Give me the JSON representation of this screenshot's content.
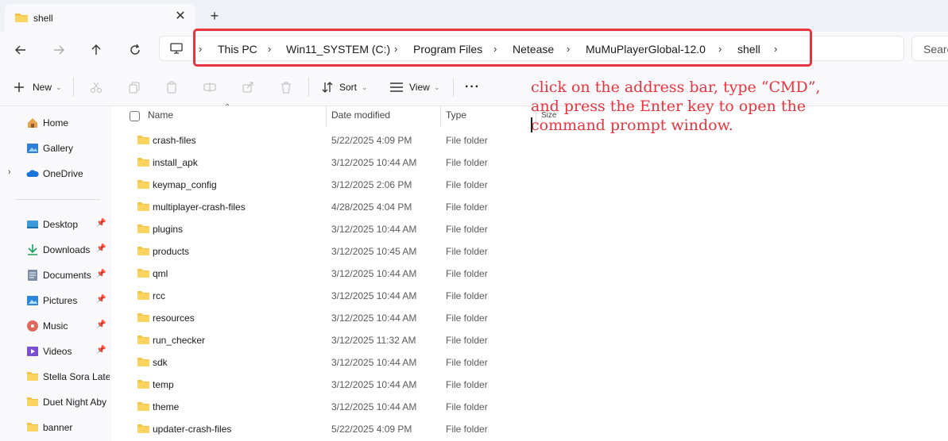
{
  "window": {
    "tab_title": "shell",
    "tab_close": "✕",
    "new_tab": "+"
  },
  "address_bar": {
    "crumbs": [
      "This PC",
      "Win11_SYSTEM (C:)",
      "Program Files",
      "Netease",
      "MuMuPlayerGlobal-12.0",
      "shell"
    ],
    "separator": "›"
  },
  "search": {
    "placeholder": "Search"
  },
  "toolbar": {
    "new_label": "New",
    "sort_label": "Sort",
    "view_label": "View",
    "more_label": "···"
  },
  "sidebar": {
    "items": [
      {
        "label": "Home",
        "icon": "home-icon"
      },
      {
        "label": "Gallery",
        "icon": "gallery-icon"
      },
      {
        "label": "OneDrive",
        "icon": "cloud-icon"
      },
      {
        "label": "Desktop",
        "icon": "desktop-icon"
      },
      {
        "label": "Downloads",
        "icon": "download-icon"
      },
      {
        "label": "Documents",
        "icon": "document-icon"
      },
      {
        "label": "Pictures",
        "icon": "pictures-icon"
      },
      {
        "label": "Music",
        "icon": "music-icon"
      },
      {
        "label": "Videos",
        "icon": "video-icon"
      },
      {
        "label": "Stella Sora Lates",
        "icon": "folder-icon"
      },
      {
        "label": "Duet Night Aby",
        "icon": "folder-icon"
      },
      {
        "label": "banner",
        "icon": "folder-icon"
      }
    ]
  },
  "columns": {
    "name": "Name",
    "date": "Date modified",
    "type": "Type",
    "size": "Size"
  },
  "files": [
    {
      "name": "crash-files",
      "date": "5/22/2025 4:09 PM",
      "type": "File folder"
    },
    {
      "name": "install_apk",
      "date": "3/12/2025 10:44 AM",
      "type": "File folder"
    },
    {
      "name": "keymap_config",
      "date": "3/12/2025 2:06 PM",
      "type": "File folder"
    },
    {
      "name": "multiplayer-crash-files",
      "date": "4/28/2025 4:04 PM",
      "type": "File folder"
    },
    {
      "name": "plugins",
      "date": "3/12/2025 10:44 AM",
      "type": "File folder"
    },
    {
      "name": "products",
      "date": "3/12/2025 10:45 AM",
      "type": "File folder"
    },
    {
      "name": "qml",
      "date": "3/12/2025 10:44 AM",
      "type": "File folder"
    },
    {
      "name": "rcc",
      "date": "3/12/2025 10:44 AM",
      "type": "File folder"
    },
    {
      "name": "resources",
      "date": "3/12/2025 10:44 AM",
      "type": "File folder"
    },
    {
      "name": "run_checker",
      "date": "3/12/2025 11:32 AM",
      "type": "File folder"
    },
    {
      "name": "sdk",
      "date": "3/12/2025 10:44 AM",
      "type": "File folder"
    },
    {
      "name": "temp",
      "date": "3/12/2025 10:44 AM",
      "type": "File folder"
    },
    {
      "name": "theme",
      "date": "3/12/2025 10:44 AM",
      "type": "File folder"
    },
    {
      "name": "updater-crash-files",
      "date": "5/22/2025 4:09 PM",
      "type": "File folder"
    }
  ],
  "annotation": {
    "text": "click on the address bar, type “CMD”,\nand press the Enter key to open the\ncommand prompt window.",
    "color": "#e8343f"
  },
  "colors": {
    "folder": "#f6c445",
    "highlight": "#e8343f"
  }
}
